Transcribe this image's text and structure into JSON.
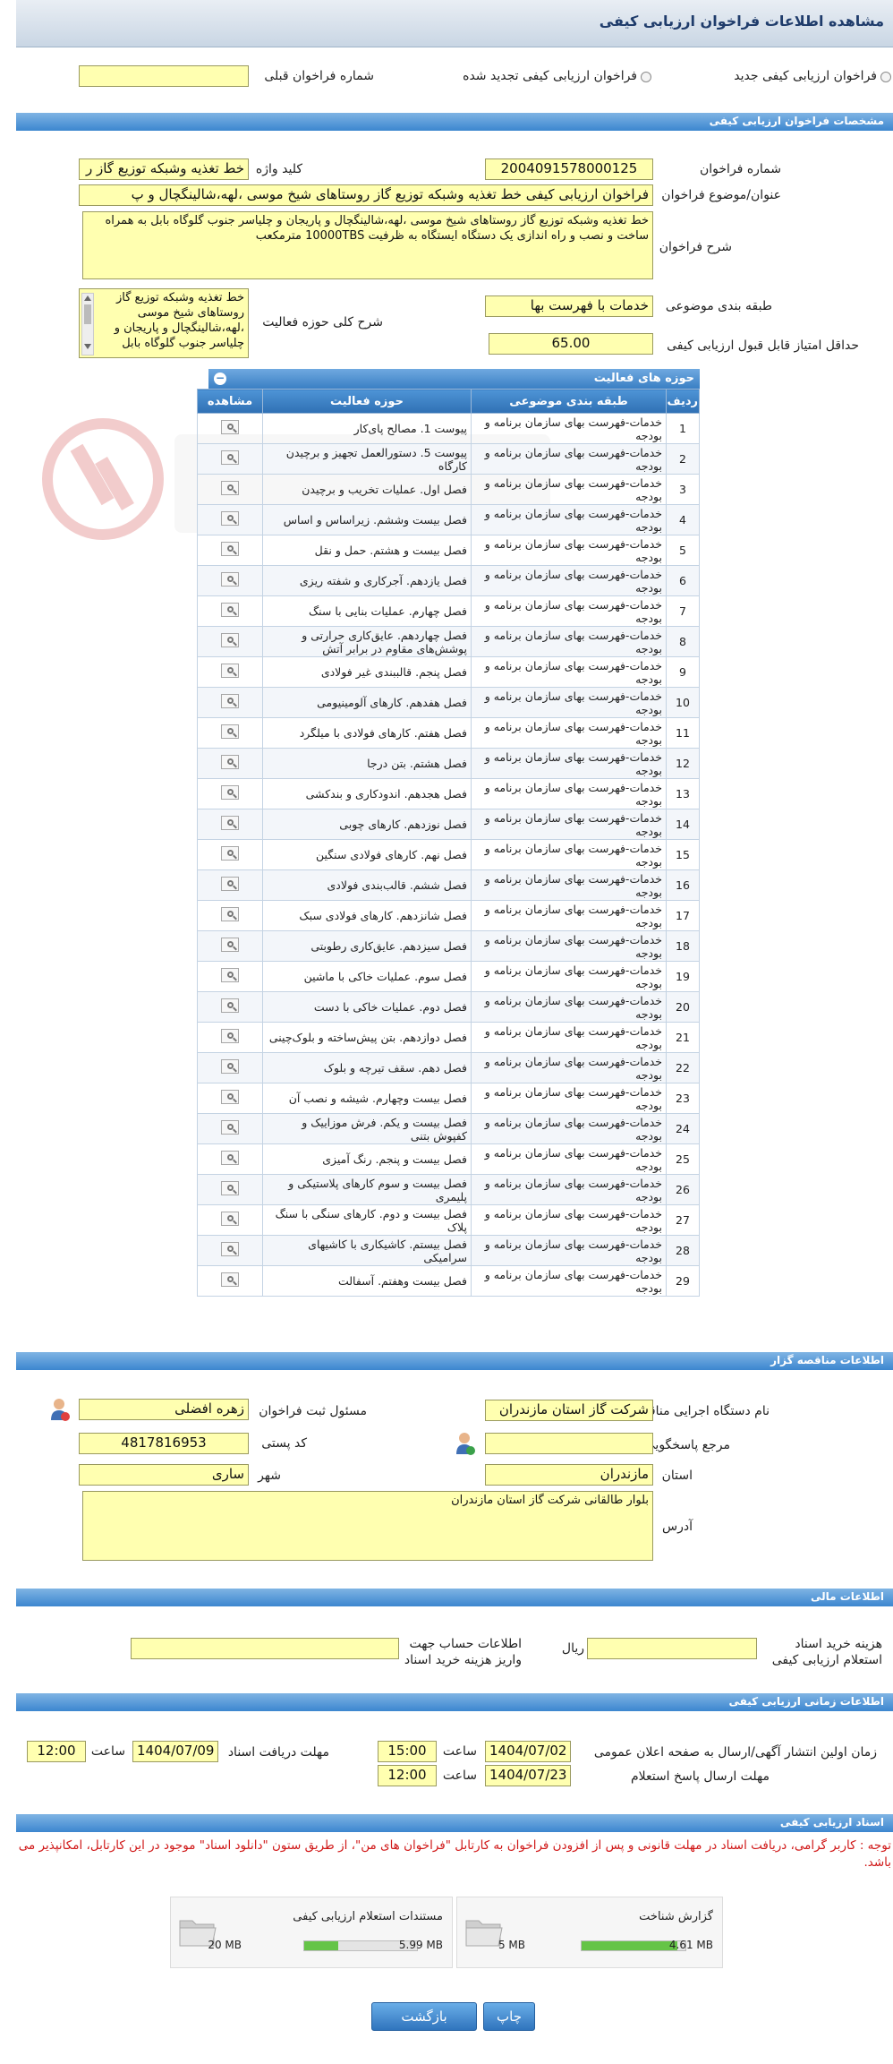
{
  "page_title": "مشاهده اطلاعات فراخوان ارزیابی کیفی",
  "options": {
    "new_label": "فراخوان ارزیابی کیفی جدید",
    "renewed_label": "فراخوان ارزیابی کیفی تجدید شده",
    "previous_number_label": "شماره فراخوان قبلی",
    "previous_number_value": ""
  },
  "specs": {
    "section_title": "مشخصات فراخوان ارزیابی کیفی",
    "number_label": "شماره فراخوان",
    "number_value": "2004091578000125",
    "keyword_label": "کلید واژه",
    "keyword_value": "خط تغذیه وشبکه توزیع گاز ر",
    "subject_label": "عنوان/موضوع فراخوان",
    "subject_value": "فراخوان ارزیابی کیفی خط تغذیه وشبکه توزیع گاز روستاهای شیخ موسی ،لهه،شالینگچال و پ",
    "description_label": "شرح فراخوان",
    "description_value": "خط تغذیه وشبکه توزیع گاز روستاهای شیخ موسی ،لهه،شالینگچال و پاریجان و چلیاسر جنوب گلوگاه بابل به همراه ساخت و نصب و راه اندازی یک دستگاه ایستگاه به ظرفیت 10000TBS مترمکعب",
    "category_label": "طبقه بندی موضوعی",
    "category_value": "خدمات با فهرست بها",
    "activity_desc_label": "شرح کلی حوزه فعالیت",
    "activity_desc_value": "خط تغذیه وشبکه توزیع گاز روستاهای شیخ موسی ،لهه،شالینگچال و پاریجان و چلیاسر جنوب گلوگاه بابل",
    "min_score_label": "حداقل امتیاز قابل قبول ارزیابی کیفی",
    "min_score_value": "65.00"
  },
  "activities": {
    "section_title": "حوزه های فعالیت",
    "headers": [
      "ردیف",
      "طبقه بندی موضوعی",
      "حوزه فعالیت",
      "مشاهده"
    ],
    "rows": [
      {
        "idx": "1",
        "cat": "خدمات-فهرست بهای سازمان برنامه و بودجه",
        "act": "پیوست 1. مصالح پای‌کار"
      },
      {
        "idx": "2",
        "cat": "خدمات-فهرست بهای سازمان برنامه و بودجه",
        "act": "پیوست 5. دستورالعمل تجهیز و برچیدن کارگاه"
      },
      {
        "idx": "3",
        "cat": "خدمات-فهرست بهای سازمان برنامه و بودجه",
        "act": "فصل اول. عملیات تخریب و برچیدن"
      },
      {
        "idx": "4",
        "cat": "خدمات-فهرست بهای سازمان برنامه و بودجه",
        "act": "فصل بیست وششم. زیراساس و اساس"
      },
      {
        "idx": "5",
        "cat": "خدمات-فهرست بهای سازمان برنامه و بودجه",
        "act": "فصل بیست و هشتم. حمل و نقل"
      },
      {
        "idx": "6",
        "cat": "خدمات-فهرست بهای سازمان برنامه و بودجه",
        "act": "فصل یازدهم. آجرکاری و شفته ریزی"
      },
      {
        "idx": "7",
        "cat": "خدمات-فهرست بهای سازمان برنامه و بودجه",
        "act": "فصل چهارم. عملیات بنایی با سنگ"
      },
      {
        "idx": "8",
        "cat": "خدمات-فهرست بهای سازمان برنامه و بودجه",
        "act": "فصل چهاردهم. عایق‌کاری حرارتی و پوشش‌های مقاوم در برابر آتش"
      },
      {
        "idx": "9",
        "cat": "خدمات-فهرست بهای سازمان برنامه و بودجه",
        "act": "فصل پنجم. قالببندی غیر فولادی"
      },
      {
        "idx": "10",
        "cat": "خدمات-فهرست بهای سازمان برنامه و بودجه",
        "act": "فصل هفدهم. کارهای آلومینیومی"
      },
      {
        "idx": "11",
        "cat": "خدمات-فهرست بهای سازمان برنامه و بودجه",
        "act": "فصل هفتم. کارهای فولادی با میلگرد"
      },
      {
        "idx": "12",
        "cat": "خدمات-فهرست بهای سازمان برنامه و بودجه",
        "act": "فصل هشتم. بتن درجا"
      },
      {
        "idx": "13",
        "cat": "خدمات-فهرست بهای سازمان برنامه و بودجه",
        "act": "فصل هجدهم. اندودکاری و بندکشی"
      },
      {
        "idx": "14",
        "cat": "خدمات-فهرست بهای سازمان برنامه و بودجه",
        "act": "فصل نوزدهم. کارهای چوبی"
      },
      {
        "idx": "15",
        "cat": "خدمات-فهرست بهای سازمان برنامه و بودجه",
        "act": "فصل نهم. کارهای فولادی سنگین"
      },
      {
        "idx": "16",
        "cat": "خدمات-فهرست بهای سازمان برنامه و بودجه",
        "act": "فصل ششم. قالب‌بندی فولادی"
      },
      {
        "idx": "17",
        "cat": "خدمات-فهرست بهای سازمان برنامه و بودجه",
        "act": "فصل شانزدهم. کارهای فولادی سبک"
      },
      {
        "idx": "18",
        "cat": "خدمات-فهرست بهای سازمان برنامه و بودجه",
        "act": "فصل سیزدهم. عایق‌کاری رطوبتی"
      },
      {
        "idx": "19",
        "cat": "خدمات-فهرست بهای سازمان برنامه و بودجه",
        "act": "فصل سوم. عملیات خاکی با ماشین"
      },
      {
        "idx": "20",
        "cat": "خدمات-فهرست بهای سازمان برنامه و بودجه",
        "act": "فصل دوم. عملیات خاکی با دست"
      },
      {
        "idx": "21",
        "cat": "خدمات-فهرست بهای سازمان برنامه و بودجه",
        "act": "فصل دوازدهم. بتن پیش‌ساخته و بلوک‌چینی"
      },
      {
        "idx": "22",
        "cat": "خدمات-فهرست بهای سازمان برنامه و بودجه",
        "act": "فصل دهم. سقف تیرچه و بلوک"
      },
      {
        "idx": "23",
        "cat": "خدمات-فهرست بهای سازمان برنامه و بودجه",
        "act": "فصل بیست وچهارم. شیشه و نصب آن"
      },
      {
        "idx": "24",
        "cat": "خدمات-فهرست بهای سازمان برنامه و بودجه",
        "act": "فصل بیست و یکم. فرش موزاییک و کفپوش بتنی"
      },
      {
        "idx": "25",
        "cat": "خدمات-فهرست بهای سازمان برنامه و بودجه",
        "act": "فصل بیست و پنجم. رنگ آمیزی"
      },
      {
        "idx": "26",
        "cat": "خدمات-فهرست بهای سازمان برنامه و بودجه",
        "act": "فصل بیست و سوم کارهای پلاستیکی و پلیمری"
      },
      {
        "idx": "27",
        "cat": "خدمات-فهرست بهای سازمان برنامه و بودجه",
        "act": "فصل بیست و دوم. کارهای سنگی با سنگ پلاک"
      },
      {
        "idx": "28",
        "cat": "خدمات-فهرست بهای سازمان برنامه و بودجه",
        "act": "فصل بیستم. کاشیکاری با کاشیهای سرامیکی"
      },
      {
        "idx": "29",
        "cat": "خدمات-فهرست بهای سازمان برنامه و بودجه",
        "act": "فصل بیست وهفتم. آسفالت"
      }
    ]
  },
  "organizer": {
    "section_title": "اطلاعات مناقصه گزار",
    "exec_label": "نام دستگاه اجرایی مناقصه گزار",
    "exec_value": "شرکت گاز استان مازندران",
    "registrar_label": "مسئول ثبت فراخوان",
    "registrar_value": "زهره افضلی",
    "reference_label": "مرجع پاسخگویی",
    "reference_value": "",
    "postal_label": "کد پستی",
    "postal_value": "4817816953",
    "province_label": "استان",
    "province_value": "مازندران",
    "city_label": "شهر",
    "city_value": "ساری",
    "address_label": "آدرس",
    "address_value": "بلوار طالقانی شرکت گاز استان مازندران"
  },
  "financial": {
    "section_title": "اطلاعات مالی",
    "fee_label": "هزینه خرید اسناد استعلام ارزیابی کیفی",
    "fee_value": "",
    "currency": "ریال",
    "account_label": "اطلاعات حساب جهت واریز هزینه خرید اسناد",
    "account_value": ""
  },
  "timing": {
    "section_title": "اطلاعات زمانی ارزیابی کیفی",
    "publish_label": "زمان اولین انتشار آگهی/ارسال به صفحه اعلان عمومی",
    "publish_date": "1404/07/02",
    "publish_time": "15:00",
    "receive_label": "مهلت دریافت اسناد",
    "receive_date": "1404/07/09",
    "receive_time": "12:00",
    "response_label": "مهلت ارسال پاسخ استعلام",
    "response_date": "1404/07/23",
    "response_time": "12:00",
    "time_label": "ساعت"
  },
  "documents": {
    "section_title": "اسناد ارزیابی کیفی",
    "notice": "توجه : کاربر گرامی، دریافت اسناد در مهلت قانونی و پس از افزودن فراخوان به کارتابل \"فراخوان های من\"، از طریق ستون \"دانلود اسناد\" موجود در این کارتابل، امکانپذیر می باشد.",
    "files": [
      {
        "name": "گزارش شناخت",
        "size": "4.61 MB",
        "max": "5 MB",
        "ratio": 0.92
      },
      {
        "name": "مستندات استعلام ارزیابی کیفی",
        "size": "5.99 MB",
        "max": "20 MB",
        "ratio": 0.3
      }
    ]
  },
  "buttons": {
    "print": "چاپ",
    "back": "بازگشت"
  },
  "colors": {
    "field_bg": "#ffffb0",
    "section_bar": "#3c86cf",
    "notice": "#d01818"
  }
}
